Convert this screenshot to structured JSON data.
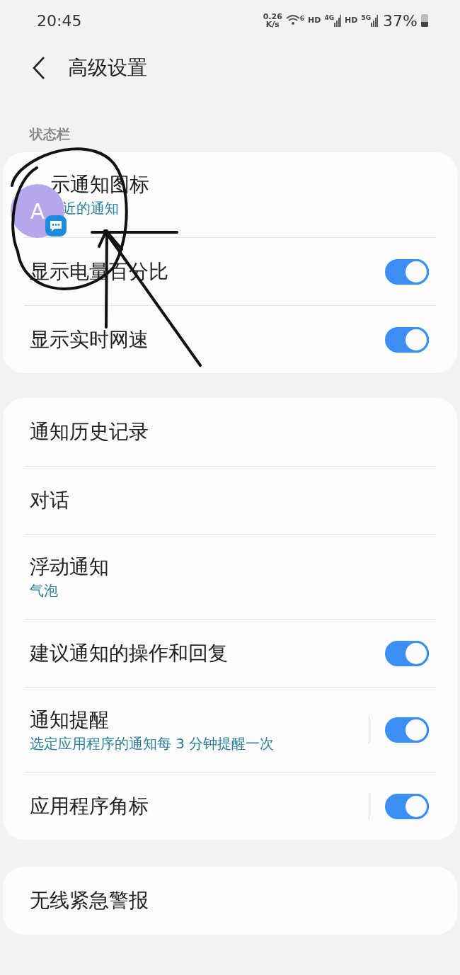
{
  "status_bar": {
    "time": "20:45",
    "net_speed": "0.26",
    "net_unit": "K/s",
    "wifi_badge": "6",
    "sim1_hd": "HD",
    "sim1_type": "4G",
    "sim2_hd": "HD",
    "sim2_type": "5G",
    "battery": "37%"
  },
  "header": {
    "title": "高级设置"
  },
  "bubble": {
    "letter": "A"
  },
  "sections": [
    {
      "label": "状态栏",
      "items": [
        {
          "kind": "plain",
          "title": "示通知图标",
          "subtitle": "近的通知",
          "covered": true
        },
        {
          "kind": "switch",
          "title": "显示电量百分比",
          "on": true
        },
        {
          "kind": "switch",
          "title": "显示实时网速",
          "on": true
        }
      ]
    },
    {
      "items": [
        {
          "kind": "plain",
          "title": "通知历史记录"
        },
        {
          "kind": "plain",
          "title": "对话"
        },
        {
          "kind": "plain",
          "title": "浮动通知",
          "subtitle": "气泡"
        },
        {
          "kind": "switch",
          "title": "建议通知的操作和回复",
          "on": true
        },
        {
          "kind": "split_switch",
          "title": "通知提醒",
          "subtitle": "选定应用程序的通知每 3 分钟提醒一次",
          "on": true
        },
        {
          "kind": "split_switch",
          "title": "应用程序角标",
          "on": true
        }
      ]
    },
    {
      "items": [
        {
          "kind": "plain",
          "title": "无线紧急警报"
        }
      ]
    }
  ]
}
